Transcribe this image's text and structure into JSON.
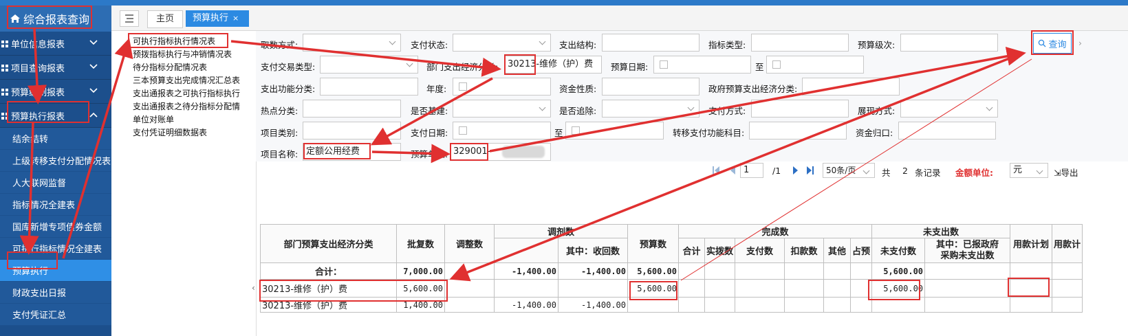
{
  "app": {
    "title": "综合报表查询"
  },
  "sidebar": {
    "groups": [
      {
        "label": "单位信息报表"
      },
      {
        "label": "项目查询报表"
      },
      {
        "label": "预算编制报表"
      },
      {
        "label": "预算执行报表"
      }
    ],
    "subitems": [
      {
        "label": "结余结转"
      },
      {
        "label": "上级转移支付分配情况表"
      },
      {
        "label": "人大联网监督"
      },
      {
        "label": "指标情况全建表"
      },
      {
        "label": "国库新增专项债券金额"
      },
      {
        "label": "可执行指标情况全建表"
      },
      {
        "label": "预算执行"
      },
      {
        "label": "财政支出日报"
      },
      {
        "label": "支付凭证汇总"
      }
    ]
  },
  "tabs": {
    "home": "主页",
    "active": "预算执行",
    "close": "×"
  },
  "tree": {
    "items": [
      "可执行指标执行情况表",
      "预拨指标执行与冲销情况表",
      "待分指标分配情况表",
      "三本预算支出完成情况汇总表",
      "支出通报表之可执行指标执行",
      "支出通报表之待分指标分配情",
      "单位对账单",
      "支付凭证明细数据表"
    ]
  },
  "form": {
    "labels": {
      "fetch_mode": "取数方式:",
      "pay_status": "支付状态:",
      "pay_structure": "支出结构:",
      "index_type": "指标类型:",
      "budget_level": "预算级次:",
      "pay_txn_type": "支付交易类型:",
      "dept_econ": "部门支出经济分类:",
      "budget_date": "预算日期:",
      "to1": "至",
      "func_class": "支出功能分类:",
      "year": "年度:",
      "fund_nature": "资金性质:",
      "gov_econ": "政府预算支出经济分类:",
      "hotspot": "热点分类:",
      "is_base": "是否基建:",
      "is_recover": "是否追除:",
      "pay_method": "支付方式:",
      "display_mode": "展现方式:",
      "project_cat": "项目类别:",
      "pay_date": "支付日期:",
      "to2": "至",
      "transfer_func": "转移支付功能科目:",
      "fund_return": "资金归口:",
      "project_name": "项目名称:",
      "budget_unit": "预算单位:"
    },
    "values": {
      "dept_econ_code": "30213",
      "dept_econ_text": "维修（护）费",
      "project_name": "定额公用经费",
      "budget_unit_code": "329001-"
    },
    "query_button": "查询",
    "more_glyph": "›"
  },
  "pager": {
    "page": "1",
    "total_pages": "/1",
    "page_size": "50条/页",
    "total_label": "共",
    "total": "2",
    "records": "条记录",
    "amount_unit_label": "金额单位:",
    "amount_unit": "元",
    "export": "导出"
  },
  "grid": {
    "headers": {
      "econ_class": "部门预算支出经济分类",
      "approved": "批复数",
      "adjust": "调整数",
      "transfer": "调剂数",
      "transfer_recover": "其中：收回数",
      "budget": "预算数",
      "completed": "完成数",
      "c_total": "合计",
      "c_allot": "实拨数",
      "c_pay": "支付数",
      "c_deduct": "扣款数",
      "c_other": "其他",
      "c_pre": "占预",
      "unpaid": "未支出数",
      "unpaid_amt": "未支付数",
      "unpaid_gov": "其中：已报政府\n采购未支出数",
      "plan1": "用款计划",
      "plan2": "用款计"
    },
    "total_row": {
      "label": "合计：",
      "approved": "7,000.00",
      "transfer": "-1,400.00",
      "recover": "-1,400.00",
      "budget": "5,600.00",
      "unpaid": "5,600.00"
    },
    "rows": [
      {
        "econ": "30213-维修（护）费",
        "approved": "5,600.00",
        "transfer": "",
        "recover": "",
        "budget": "5,600.00",
        "unpaid": "5,600.00"
      },
      {
        "econ": "30213-维修（护）费",
        "approved": "1,400.00",
        "transfer": "-1,400.00",
        "recover": "-1,400.00",
        "budget": "",
        "unpaid": ""
      }
    ]
  },
  "colors": {
    "sidebar_bg": "#1c4f8c",
    "accent": "#2c8ae2",
    "annotation": "#e03030"
  },
  "icons": [
    "home-icon",
    "menu-icon",
    "chevron-down-icon",
    "chevron-up-icon",
    "calendar-icon",
    "search-icon",
    "export-icon",
    "first-page-icon",
    "prev-page-icon",
    "next-page-icon",
    "last-page-icon"
  ]
}
